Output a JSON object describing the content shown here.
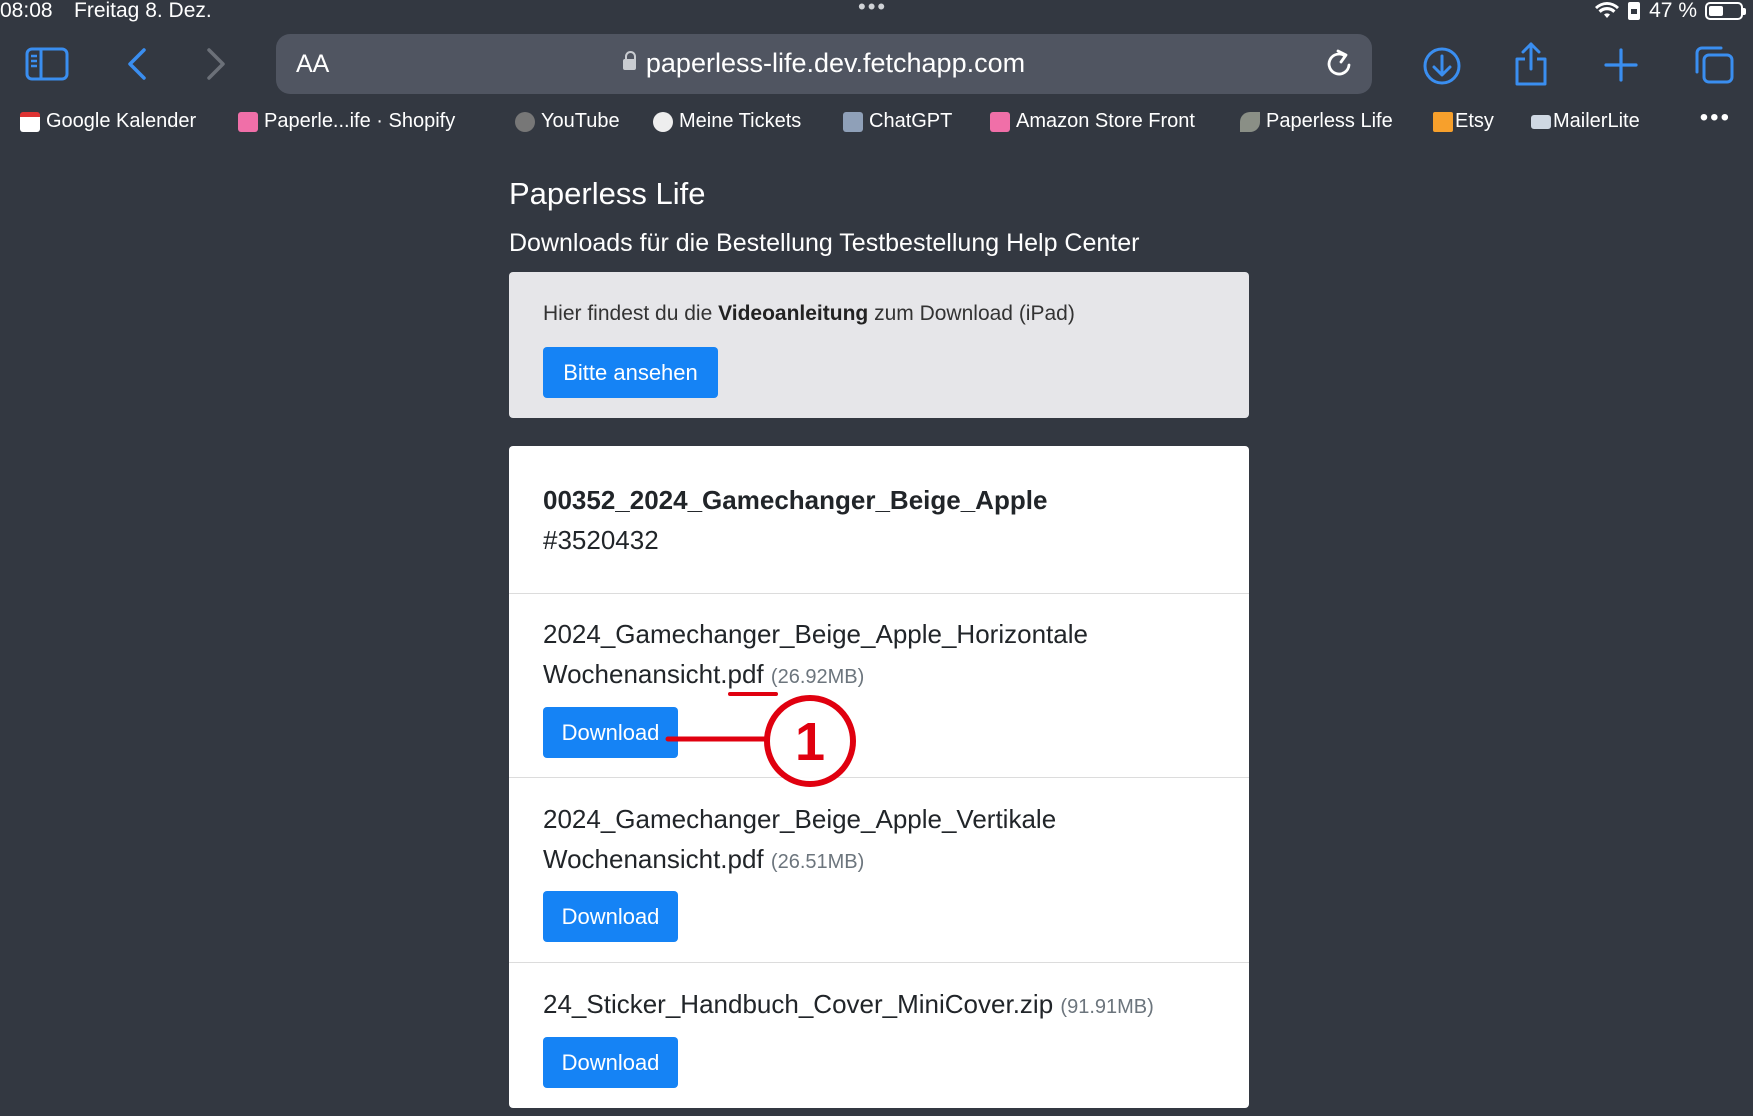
{
  "status_bar": {
    "time": "08:08",
    "date": "Freitag 8. Dez.",
    "battery": "47 %",
    "battery_level": 0.47
  },
  "toolbar": {
    "text_size_label": "AA",
    "url": "paperless-life.dev.fetchapp.com",
    "accent_color": "#3a8ef0"
  },
  "bookmarks": [
    {
      "label": "Google Kalender",
      "icon": "calendar-icon"
    },
    {
      "label": "Paperle...ife · Shopify",
      "icon": "shopify-bag-icon"
    },
    {
      "label": "YouTube",
      "icon": "youtube-icon"
    },
    {
      "label": "Meine Tickets",
      "icon": "speech-bubble-icon"
    },
    {
      "label": "ChatGPT",
      "icon": "robot-icon"
    },
    {
      "label": "Amazon Store Front",
      "icon": "shopify-bag-icon"
    },
    {
      "label": "Paperless Life",
      "icon": "leaf-icon"
    },
    {
      "label": "Etsy",
      "icon": "etsy-icon"
    },
    {
      "label": "MailerLite",
      "icon": "mail-icon"
    }
  ],
  "page": {
    "title": "Paperless Life",
    "subtitle": "Downloads für die Bestellung Testbestellung Help Center",
    "info": {
      "text_before": "Hier findest du die ",
      "text_bold": "Videoanleitung",
      "text_after": " zum Download (iPad)",
      "button_label": "Bitte ansehen"
    },
    "order": {
      "title": "00352_2024_Gamechanger_Beige_Apple",
      "number": "#3520432"
    },
    "files": [
      {
        "name_line1": "2024_Gamechanger_Beige_Apple_Horizontale",
        "name_line2": "Wochenansicht.pdf",
        "size": "(26.92MB)",
        "button_label": "Download"
      },
      {
        "name_line1": "2024_Gamechanger_Beige_Apple_Vertikale",
        "name_line2": "Wochenansicht.pdf",
        "size": "(26.51MB)",
        "button_label": "Download"
      },
      {
        "name_line1": "24_Sticker_Handbuch_Cover_MiniCover.zip",
        "name_line2": "",
        "size": "(91.91MB)",
        "button_label": "Download"
      }
    ],
    "primary_color": "#1583f5"
  },
  "annotation": {
    "marker": "1",
    "color": "#e0000f"
  }
}
